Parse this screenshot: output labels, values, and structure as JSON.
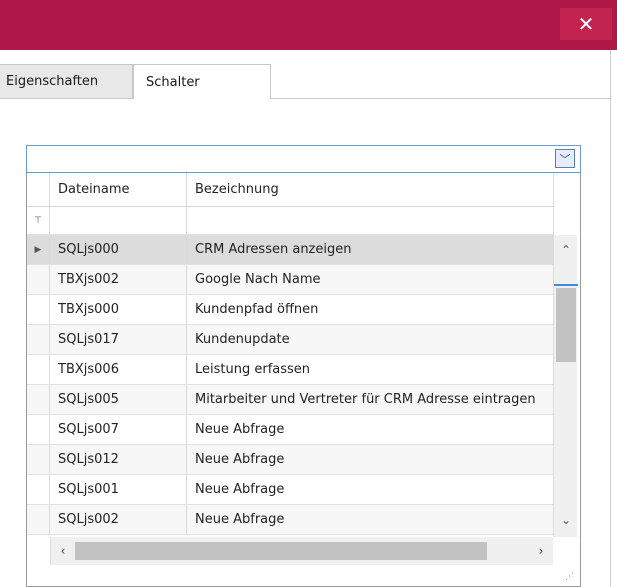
{
  "window": {
    "close_glyph": "✕"
  },
  "tabs": [
    {
      "label": "Eigenschaften"
    },
    {
      "label": "Schalter"
    }
  ],
  "combo": {
    "value": "",
    "arrow_glyph": "﹀"
  },
  "grid": {
    "columns": [
      "Dateiname",
      "Bezeichnung"
    ],
    "filter_glyph": "⊤",
    "row_indicator_glyph": "▶",
    "rows": [
      {
        "dateiname": "SQLjs000",
        "bezeichnung": "CRM Adressen anzeigen",
        "selected": true
      },
      {
        "dateiname": "TBXjs002",
        "bezeichnung": "Google Nach Name"
      },
      {
        "dateiname": "TBXjs000",
        "bezeichnung": "Kundenpfad öffnen"
      },
      {
        "dateiname": "SQLjs017",
        "bezeichnung": "Kundenupdate"
      },
      {
        "dateiname": "TBXjs006",
        "bezeichnung": "Leistung erfassen"
      },
      {
        "dateiname": "SQLjs005",
        "bezeichnung": "Mitarbeiter und Vertreter für CRM Adresse eintragen"
      },
      {
        "dateiname": "SQLjs007",
        "bezeichnung": "Neue Abfrage"
      },
      {
        "dateiname": "SQLjs012",
        "bezeichnung": "Neue Abfrage"
      },
      {
        "dateiname": "SQLjs001",
        "bezeichnung": "Neue Abfrage"
      },
      {
        "dateiname": "SQLjs002",
        "bezeichnung": "Neue Abfrage"
      }
    ]
  },
  "scroll": {
    "up": "⌃",
    "down": "⌄",
    "left": "‹",
    "right": "›"
  },
  "colors": {
    "titlebar": "#b0174a",
    "selection": "#dcdcdc",
    "accent": "#3a8fe0"
  }
}
